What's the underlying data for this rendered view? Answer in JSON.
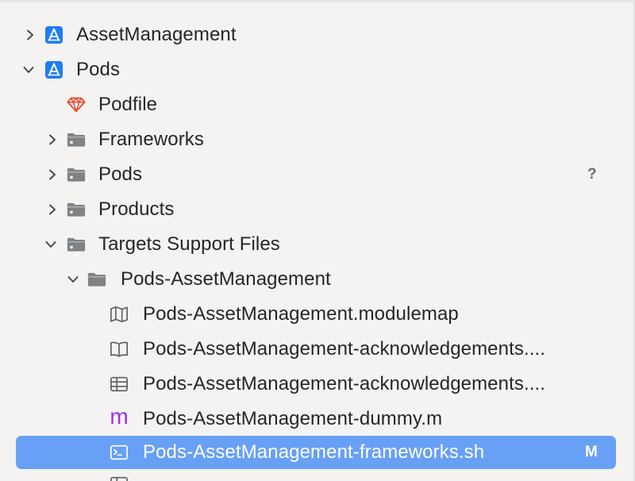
{
  "tree": {
    "items": [
      {
        "label": "AssetManagement",
        "icon": "xcode-project-icon",
        "disclosure": "collapsed",
        "badge": ""
      },
      {
        "label": "Pods",
        "icon": "xcode-project-icon",
        "disclosure": "expanded",
        "badge": ""
      },
      {
        "label": "Podfile",
        "icon": "ruby-gem-icon",
        "disclosure": "none",
        "badge": ""
      },
      {
        "label": "Frameworks",
        "icon": "folder-icon",
        "disclosure": "collapsed",
        "badge": ""
      },
      {
        "label": "Pods",
        "icon": "folder-icon",
        "disclosure": "collapsed",
        "badge": "?"
      },
      {
        "label": "Products",
        "icon": "folder-icon",
        "disclosure": "collapsed",
        "badge": ""
      },
      {
        "label": "Targets Support Files",
        "icon": "folder-icon",
        "disclosure": "expanded",
        "badge": ""
      },
      {
        "label": "Pods-AssetManagement",
        "icon": "folder-icon",
        "disclosure": "expanded",
        "badge": ""
      },
      {
        "label": "Pods-AssetManagement.modulemap",
        "icon": "map-icon",
        "disclosure": "none",
        "badge": ""
      },
      {
        "label": "Pods-AssetManagement-acknowledgements....",
        "icon": "book-icon",
        "disclosure": "none",
        "badge": ""
      },
      {
        "label": "Pods-AssetManagement-acknowledgements....",
        "icon": "table-icon",
        "disclosure": "none",
        "badge": ""
      },
      {
        "label": "Pods-AssetManagement-dummy.m",
        "icon": "objc-source-icon",
        "disclosure": "none",
        "badge": ""
      },
      {
        "label": "Pods-AssetManagement-frameworks.sh",
        "icon": "terminal-script-icon",
        "disclosure": "none",
        "badge": "M"
      }
    ],
    "objc_glyph": "m"
  },
  "colors": {
    "selection": "#68a0f6",
    "project_icon": "#1f7cf5",
    "gem_icon": "#ec4a2c",
    "folder": "#808385",
    "objc": "#a12ee3"
  }
}
